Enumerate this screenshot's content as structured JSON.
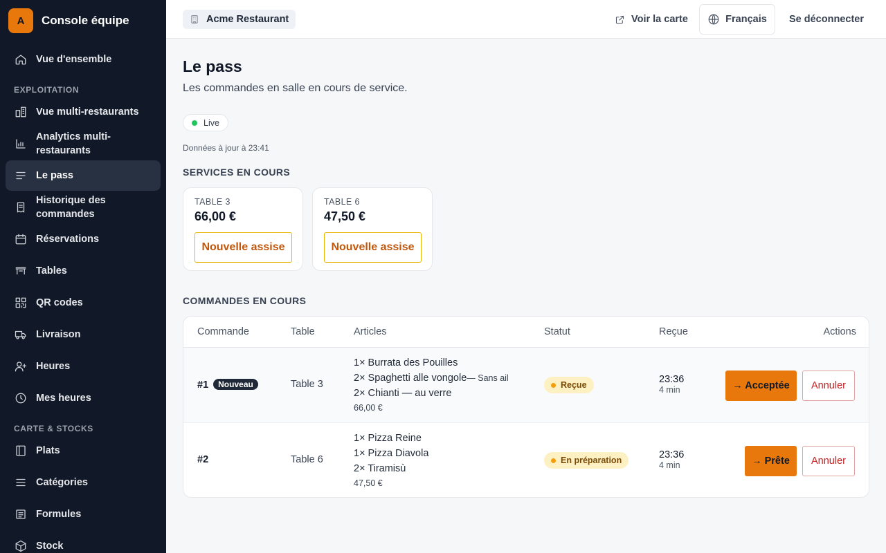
{
  "sidebar": {
    "brand_initial": "A",
    "brand_name": "Console équipe",
    "overview": "Vue d'ensemble",
    "section_exploitation": "EXPLOITATION",
    "section_carte": "CARTE & STOCKS",
    "items": [
      {
        "label": "Vue multi-restaurants",
        "icon": "buildings-icon"
      },
      {
        "label": "Analytics multi-restaurants",
        "icon": "bar-chart-icon"
      },
      {
        "label": "Le pass",
        "icon": "list-icon",
        "active": true
      },
      {
        "label": "Historique des commandes",
        "icon": "receipt-icon"
      },
      {
        "label": "Réservations",
        "icon": "calendar-icon"
      },
      {
        "label": "Tables",
        "icon": "table-icon"
      },
      {
        "label": "QR codes",
        "icon": "qr-code-icon"
      },
      {
        "label": "Livraison",
        "icon": "truck-icon"
      },
      {
        "label": "Heures",
        "icon": "user-plus-icon"
      },
      {
        "label": "Mes heures",
        "icon": "clock-icon"
      }
    ],
    "carte_items": [
      {
        "label": "Plats",
        "icon": "book-icon"
      },
      {
        "label": "Catégories",
        "icon": "menu-icon"
      },
      {
        "label": "Formules",
        "icon": "document-icon"
      },
      {
        "label": "Stock",
        "icon": "box-icon"
      }
    ]
  },
  "topbar": {
    "restaurant": "Acme Restaurant",
    "view_menu": "Voir la carte",
    "language": "Français",
    "logout": "Se déconnecter"
  },
  "page": {
    "title": "Le pass",
    "subtitle": "Les commandes en salle en cours de service.",
    "live": "Live",
    "updated": "Données à jour à 23:41"
  },
  "services": {
    "title": "SERVICES EN COURS",
    "cards": [
      {
        "table": "TABLE 3",
        "amount": "66,00 €",
        "button": "Nouvelle assise"
      },
      {
        "table": "TABLE 6",
        "amount": "47,50 €",
        "button": "Nouvelle assise"
      }
    ]
  },
  "orders": {
    "title": "COMMANDES EN COURS",
    "headers": {
      "order": "Commande",
      "table": "Table",
      "items": "Articles",
      "status": "Statut",
      "received": "Reçue",
      "actions": "Actions"
    },
    "rows": [
      {
        "number": "#1",
        "badge": "Nouveau",
        "table": "Table 3",
        "items": [
          "1× Burrata des Pouilles",
          "2× Spaghetti alle vongole",
          "2× Chianti — au verre"
        ],
        "item_note": "— Sans ail",
        "total": "66,00 €",
        "status": "Reçue",
        "time": "23:36",
        "ago": "4 min",
        "action": "→ Acceptée",
        "cancel": "Annuler"
      },
      {
        "number": "#2",
        "badge": "",
        "table": "Table 6",
        "items": [
          "1× Pizza Reine",
          "1× Pizza Diavola",
          "2× Tiramisù"
        ],
        "item_note": "",
        "total": "47,50 €",
        "status": "En préparation",
        "time": "23:36",
        "ago": "4 min",
        "action": "→ Prête",
        "cancel": "Annuler"
      }
    ]
  },
  "colors": {
    "sidebar_bg": "#111827",
    "accent": "#e8780c",
    "live": "#22c55e",
    "status_bg": "#fdf1c4",
    "danger": "#c41e1e"
  }
}
